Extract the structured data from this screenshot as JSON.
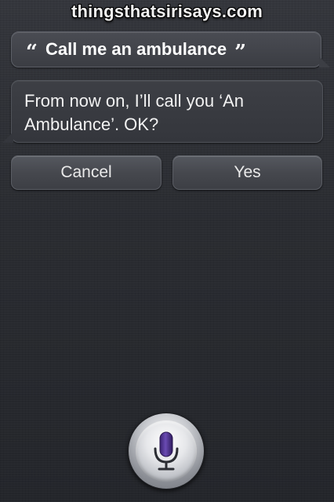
{
  "watermark": {
    "text": "thingsthatsirisays.com"
  },
  "conversation": {
    "user_quote_open": "“",
    "user_utterance": "Call me an ambulance",
    "user_quote_close": "”",
    "siri_response": "From now on, I’ll call you ‘An Ambulance’. OK?"
  },
  "actions": {
    "cancel_label": "Cancel",
    "yes_label": "Yes"
  },
  "icons": {
    "microphone": "microphone-icon",
    "mic_color": "#5a3a9a"
  }
}
